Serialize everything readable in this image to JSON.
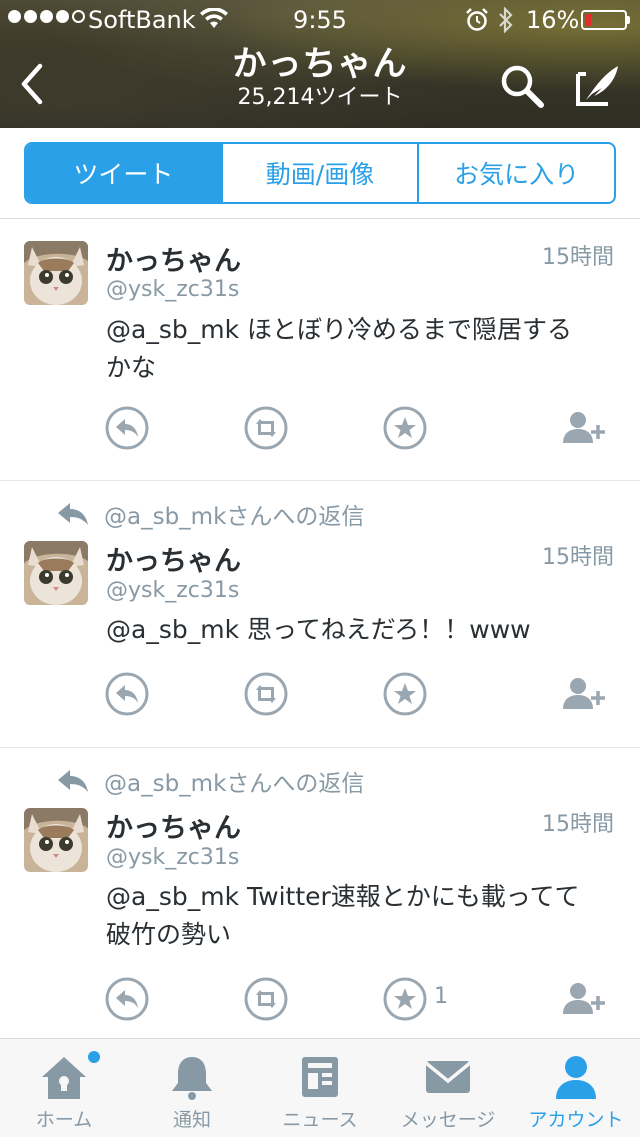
{
  "status_bar": {
    "carrier": "SoftBank",
    "time": "9:55",
    "battery_percent_label": "16%",
    "battery_level": 0.16,
    "signal_bars_filled": 4,
    "signal_bars_total": 5
  },
  "header": {
    "title": "かっちゃん",
    "subtitle": "25,214ツイート"
  },
  "tabs_segment": {
    "items": [
      {
        "label": "ツイート",
        "active": true
      },
      {
        "label": "動画/画像",
        "active": false
      },
      {
        "label": "お気に入り",
        "active": false
      }
    ]
  },
  "tweets": [
    {
      "reply_context": "",
      "name": "かっちゃん",
      "handle": "@ysk_zc31s",
      "time": "15時間",
      "text_line1": "@a_sb_mk ほとぼり冷めるまで隠居する",
      "text_line2": "かな",
      "fav_count": ""
    },
    {
      "reply_context": "@a_sb_mkさんへの返信",
      "name": "かっちゃん",
      "handle": "@ysk_zc31s",
      "time": "15時間",
      "text_line1": "@a_sb_mk 思ってねえだろ！！www",
      "text_line2": "",
      "fav_count": ""
    },
    {
      "reply_context": "@a_sb_mkさんへの返信",
      "name": "かっちゃん",
      "handle": "@ysk_zc31s",
      "time": "15時間",
      "text_line1": "@a_sb_mk Twitter速報とかにも載ってて",
      "text_line2": "破竹の勢い",
      "fav_count": "1"
    }
  ],
  "tab_bar": {
    "items": [
      {
        "label": "ホーム",
        "icon": "home-icon",
        "active": false,
        "badge": true
      },
      {
        "label": "通知",
        "icon": "bell-icon",
        "active": false
      },
      {
        "label": "ニュース",
        "icon": "news-icon",
        "active": false
      },
      {
        "label": "メッセージ",
        "icon": "envelope-icon",
        "active": false
      },
      {
        "label": "アカウント",
        "icon": "person-icon",
        "active": true
      }
    ]
  },
  "colors": {
    "accent": "#2aa0e8",
    "secondary_text": "#8899a6",
    "battery_low": "#e52c2c"
  }
}
